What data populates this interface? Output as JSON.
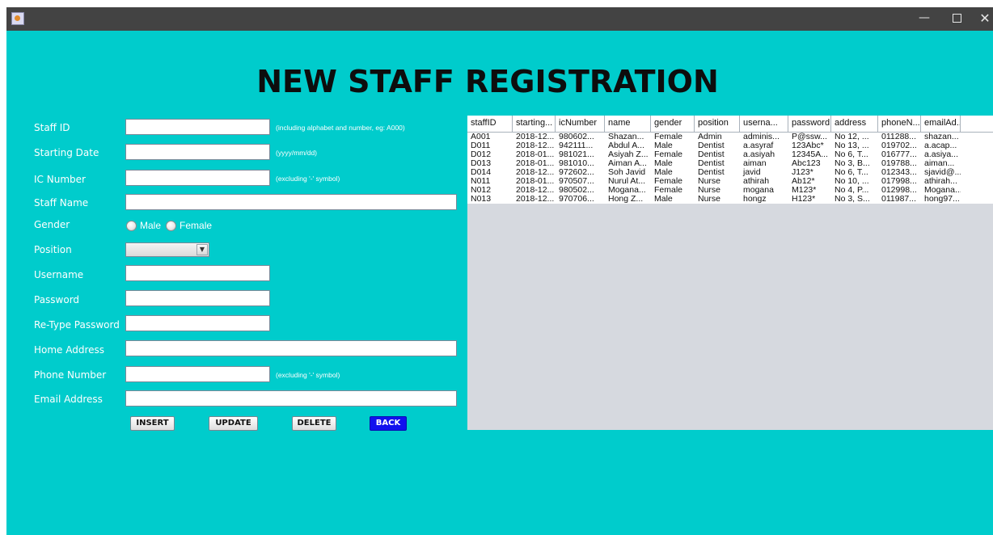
{
  "window": {
    "minimize": "—",
    "close": "✕"
  },
  "page": {
    "title": "NEW STAFF REGISTRATION"
  },
  "form": {
    "staff_id_label": "Staff ID",
    "staff_id_value": "",
    "staff_id_hint": "(including alphabet and number, eg: A000)",
    "starting_date_label": "Starting Date",
    "starting_date_value": "",
    "starting_date_hint": "(yyyy/mm/dd)",
    "ic_number_label": "IC Number",
    "ic_number_value": "",
    "ic_number_hint": "(excluding '-' symbol)",
    "staff_name_label": "Staff Name",
    "staff_name_value": "",
    "gender_label": "Gender",
    "gender_male": "Male",
    "gender_female": "Female",
    "position_label": "Position",
    "position_value": "",
    "username_label": "Username",
    "password_label": "Password",
    "retype_password_label": "Re-Type Password",
    "home_address_label": "Home Address",
    "phone_number_label": "Phone Number",
    "phone_number_hint": "(excluding '-' symbol)",
    "email_address_label": "Email Address"
  },
  "buttons": {
    "insert": "INSERT",
    "update": "UPDATE",
    "delete": "DELETE",
    "back": "BACK",
    "back_color": "#1111ee"
  },
  "colors": {
    "background": "#00cccc",
    "titlebar": "#434343"
  },
  "table": {
    "columns": [
      "staffID",
      "starting...",
      "icNumber",
      "name",
      "gender",
      "position",
      "userna...",
      "password",
      "address",
      "phoneN...",
      "emailAd..."
    ],
    "rows": [
      [
        "A001",
        "2018-12...",
        "980602...",
        "Shazan...",
        "Female",
        "Admin",
        "adminis...",
        "P@ssw...",
        "No 12, ...",
        "011288...",
        "shazan..."
      ],
      [
        "D011",
        "2018-12...",
        "942111...",
        "Abdul A...",
        "Male",
        "Dentist",
        "a.asyraf",
        "123Abc*",
        "No 13, ...",
        "019702...",
        "a.acap..."
      ],
      [
        "D012",
        "2018-01...",
        "981021...",
        "Asiyah Z...",
        "Female",
        "Dentist",
        "a.asiyah",
        "12345A...",
        "No 6, T...",
        "016777...",
        "a.asiya..."
      ],
      [
        "D013",
        "2018-01...",
        "981010...",
        "Aiman A...",
        "Male",
        "Dentist",
        "aiman",
        "Abc123",
        "No 3, B...",
        "019788...",
        "aiman..."
      ],
      [
        "D014",
        "2018-12...",
        "972602...",
        "Soh Javid",
        "Male",
        "Dentist",
        "javid",
        "J123*",
        "No 6, T...",
        "012343...",
        "sjavid@..."
      ],
      [
        "N011",
        "2018-01...",
        "970507...",
        "Nurul At...",
        "Female",
        "Nurse",
        "athirah",
        "Ab12*",
        "No 10, ...",
        "017998...",
        "athirah..."
      ],
      [
        "N012",
        "2018-12...",
        "980502...",
        "Mogana...",
        "Female",
        "Nurse",
        "mogana",
        "M123*",
        "No 4, P...",
        "012998...",
        "Mogana..."
      ],
      [
        "N013",
        "2018-12...",
        "970706...",
        "Hong Z...",
        "Male",
        "Nurse",
        "hongz",
        "H123*",
        "No 3, S...",
        "011987...",
        "hong97..."
      ]
    ]
  }
}
